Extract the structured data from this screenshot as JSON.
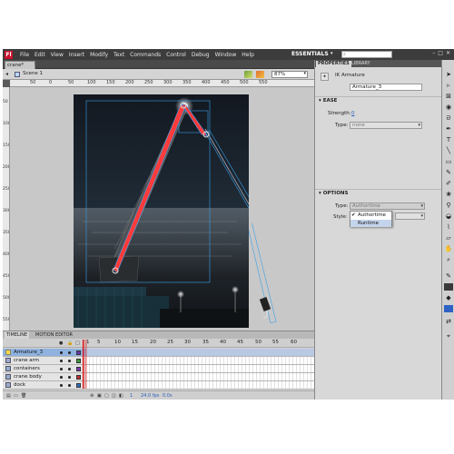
{
  "app": {
    "logo": "Fl"
  },
  "menu": [
    "File",
    "Edit",
    "View",
    "Insert",
    "Modify",
    "Text",
    "Commands",
    "Control",
    "Debug",
    "Window",
    "Help"
  ],
  "workspace": {
    "label": "ESSENTIALS",
    "arrow_icon": "chevron-down-icon"
  },
  "window_buttons": [
    "–",
    "□",
    "✕"
  ],
  "document": {
    "tab": "crane*",
    "close": "×"
  },
  "editbar": {
    "scene": "Scene 1",
    "zoom": "87%"
  },
  "ruler_top": [
    "50",
    "0",
    "50",
    "100",
    "150",
    "200",
    "250",
    "300",
    "350",
    "400",
    "450",
    "500",
    "550"
  ],
  "ruler_left": [
    "50",
    "100",
    "150",
    "200",
    "250",
    "300",
    "350",
    "400",
    "450",
    "500",
    "550"
  ],
  "timeline": {
    "tabs": [
      "TIMELINE",
      "MOTION EDITOR"
    ],
    "frame_numbers": [
      "1",
      "5",
      "10",
      "15",
      "20",
      "25",
      "30",
      "35",
      "40",
      "45",
      "50",
      "55",
      "60"
    ],
    "layers": [
      {
        "name": "Armature_3",
        "selected": true
      },
      {
        "name": "crane arm",
        "color": "#3a9a3a"
      },
      {
        "name": "containers",
        "color": "#7a3ab0"
      },
      {
        "name": "crane body",
        "color": "#c03030"
      },
      {
        "name": "dock",
        "color": "#3070c0"
      }
    ],
    "footer": {
      "frame": "1",
      "fps": "24.0 fps",
      "time": "0.0s"
    }
  },
  "panel": {
    "tabs": {
      "properties": "PROPERTIES",
      "library": "LIBRARY"
    },
    "object_type": "IK Armature",
    "name": "Armature_3",
    "ease": {
      "header": "EASE",
      "strength_label": "Strength:",
      "strength_value": "0",
      "type_label": "Type:",
      "type_value": "none"
    },
    "options": {
      "header": "OPTIONS",
      "type_label": "Type:",
      "type_value": "Authortime",
      "style_label": "Style:",
      "dropdown": [
        "Authortime",
        "Runtime"
      ]
    }
  },
  "colors": {
    "bone": "#ff3b3b",
    "selection": "#3aa0e8",
    "stage_dark": "#131820"
  }
}
